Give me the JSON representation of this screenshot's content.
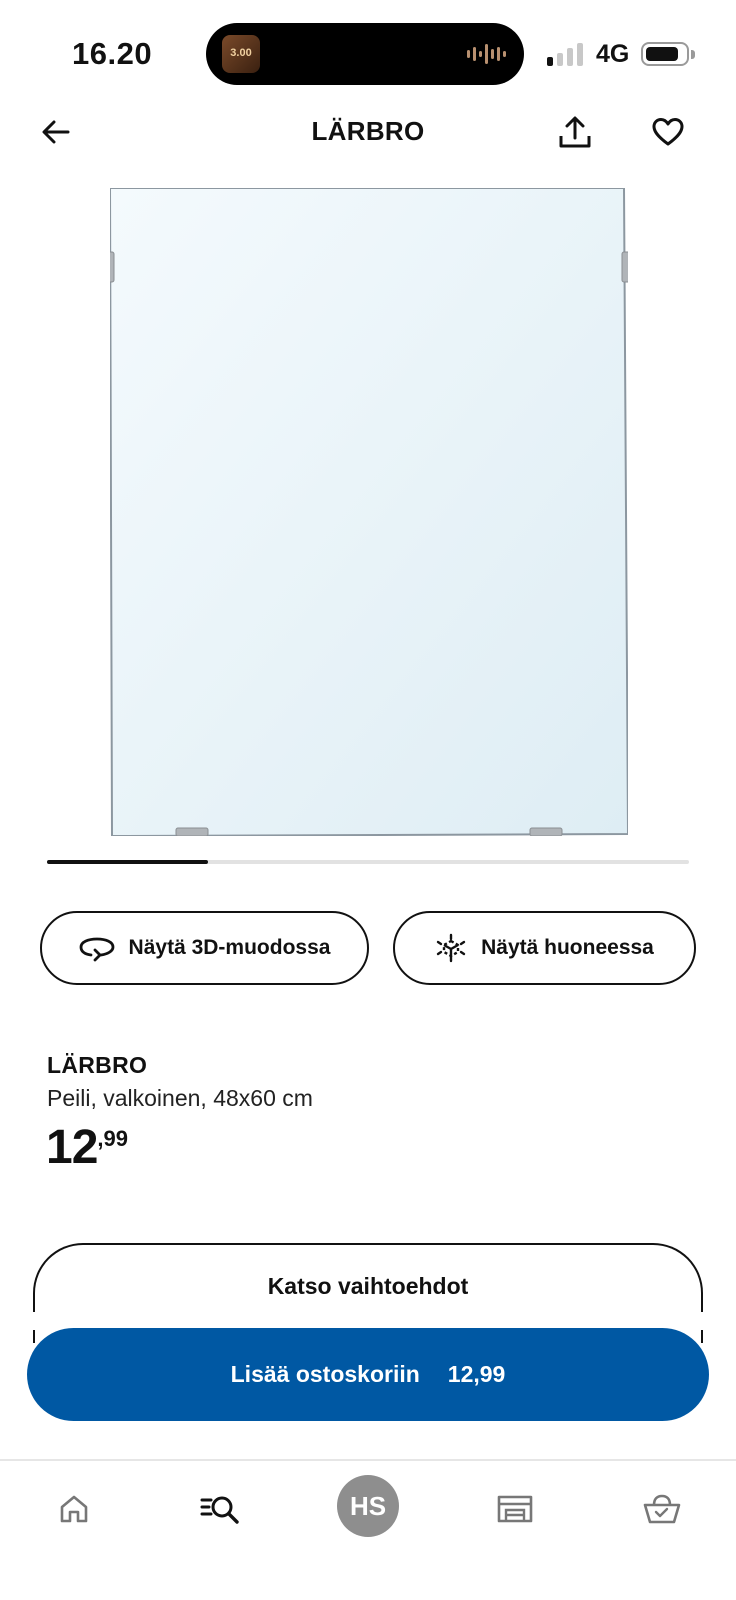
{
  "status_bar": {
    "time": "16.20",
    "network": "4G",
    "island_art_text": "3.00",
    "signal_bars_active": 1,
    "signal_bars_total": 4
  },
  "header": {
    "title": "LÄRBRO",
    "back_icon": "arrow-left-icon",
    "share_icon": "share-icon",
    "favorite_icon": "heart-icon"
  },
  "gallery": {
    "image_subject": "mirror",
    "progress": 0.25
  },
  "actions": {
    "view_3d_label": "Näytä 3D-muodossa",
    "view_3d_icon": "rotate-3d-icon",
    "view_room_label": "Näytä huoneessa",
    "view_room_icon": "ar-cube-icon"
  },
  "product": {
    "name": "LÄRBRO",
    "description": "Peili, valkoinen, 48x60 cm",
    "price_integer": "12",
    "price_decimal": ",99"
  },
  "buttons": {
    "options_label": "Katso vaihtoehdot",
    "add_to_cart_label": "Lisää ostoskoriin",
    "add_to_cart_price": "12,99"
  },
  "bottom_nav": {
    "items": [
      {
        "name": "home",
        "icon": "home-icon"
      },
      {
        "name": "search",
        "icon": "search-list-icon"
      },
      {
        "name": "profile",
        "avatar_text": "HS"
      },
      {
        "name": "stores",
        "icon": "store-icon"
      },
      {
        "name": "cart",
        "icon": "basket-icon"
      }
    ]
  },
  "colors": {
    "primary_blue": "#0058a3",
    "text": "#111111",
    "avatar_gray": "#8e8e8e"
  }
}
